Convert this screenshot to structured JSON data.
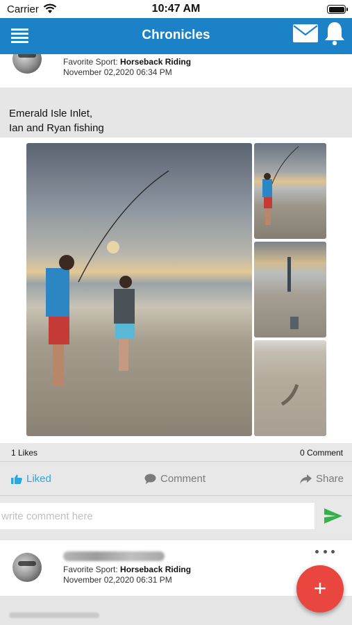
{
  "status_bar": {
    "carrier": "Carrier",
    "time": "10:47 AM"
  },
  "nav": {
    "title": "Chronicles"
  },
  "previous_post": {
    "sport_label": "Favorite Sport:",
    "sport_value": "Horseback Riding",
    "date": "November 02,2020 06:34 PM"
  },
  "post": {
    "caption": "Emerald Isle Inlet,\nIan and Ryan fishing",
    "likes": "1 Likes",
    "comments": "0 Comment",
    "actions": {
      "liked": "Liked",
      "comment": "Comment",
      "share": "Share"
    },
    "comment_placeholder": "write comment here"
  },
  "next_post": {
    "sport_label": "Favorite Sport:",
    "sport_value": "Horseback Riding",
    "date": "November 02,2020 06:31 PM"
  },
  "fab": {
    "label": "+"
  },
  "colors": {
    "nav": "#1b82c8",
    "liked": "#2aa7de",
    "send": "#33b249",
    "fab": "#e8463e"
  }
}
